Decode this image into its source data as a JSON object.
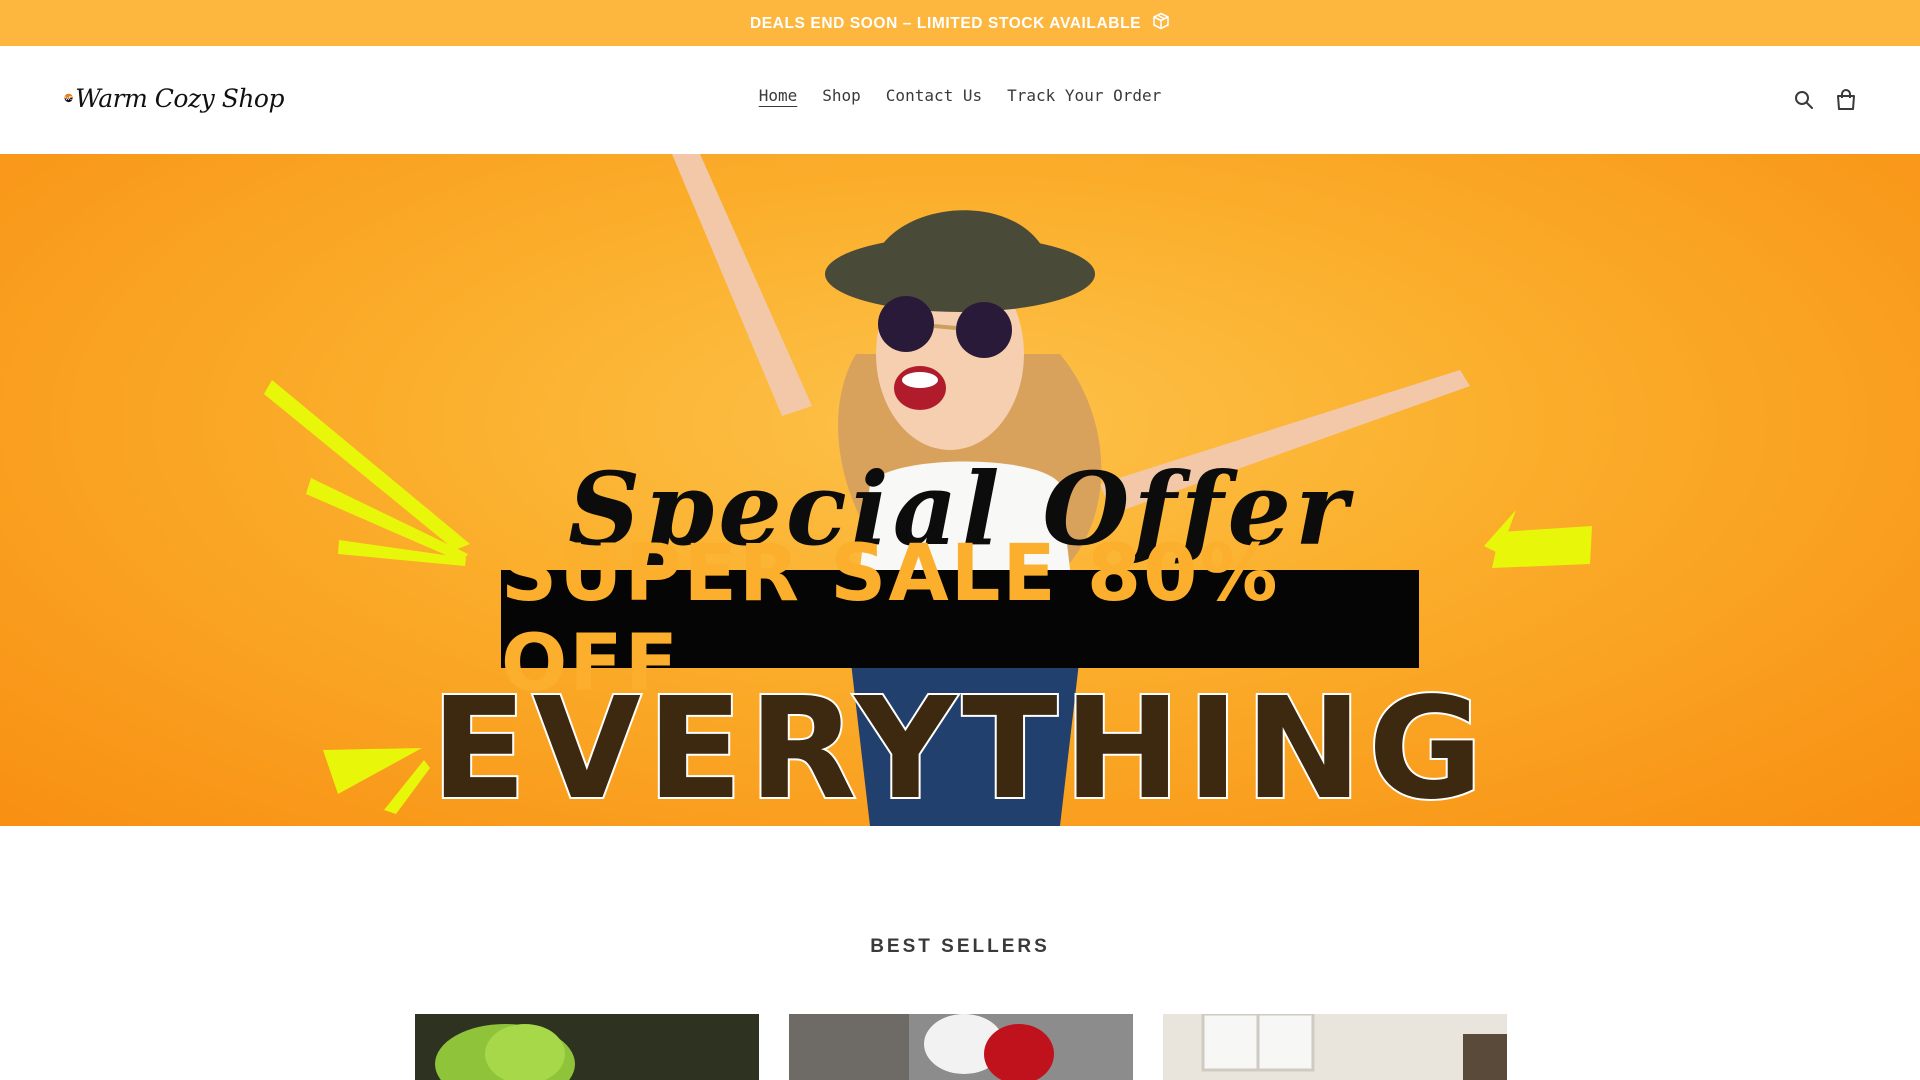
{
  "announcement": {
    "text": "DEALS END SOON – LIMITED STOCK AVAILABLE",
    "icon": "package-icon"
  },
  "header": {
    "logo_text": "Warm Cozy Shop",
    "nav": [
      {
        "label": "Home",
        "active": true
      },
      {
        "label": "Shop",
        "active": false
      },
      {
        "label": "Contact Us",
        "active": false
      },
      {
        "label": "Track Your Order",
        "active": false
      }
    ],
    "icons": [
      "search-icon",
      "cart-icon"
    ]
  },
  "hero": {
    "script_text": "Special Offer",
    "sale_text": "SUPER SALE 80% OFF",
    "big_text": "EVERYTHING"
  },
  "best_sellers": {
    "title": "BEST SELLERS",
    "products": [
      "product-1",
      "product-2",
      "product-3"
    ]
  },
  "colors": {
    "announcement_bg": "#fdb73e",
    "hero_orange": "#fbaf2c",
    "accent_yellow": "#e8f70a"
  }
}
